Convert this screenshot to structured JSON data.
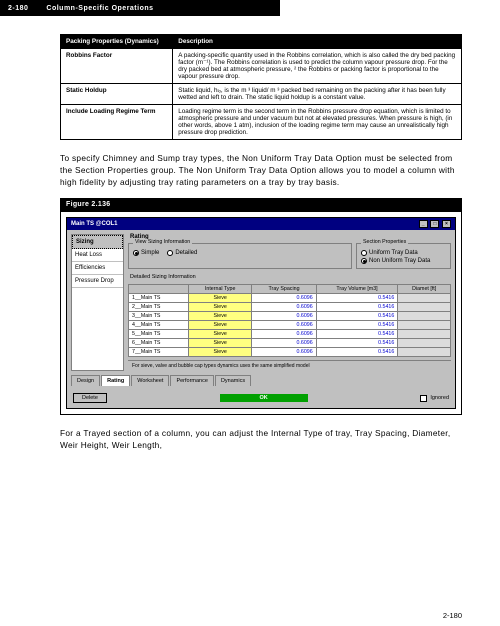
{
  "header": {
    "section_num": "2-180",
    "section_title": "Column-Specific Operations"
  },
  "prop_table": {
    "head": [
      "Packing Properties (Dynamics)",
      "Description"
    ],
    "rows": [
      {
        "name": "Robbins Factor",
        "desc": "A packing-specific quantity used in the Robbins correlation, which is also called the dry bed packing factor (m⁻¹). The Robbins correlation is used to predict the column vapour pressure drop. For the dry packed bed at atmospheric pressure, ² the Robbins or packing factor is proportional to the vapour pressure drop."
      },
      {
        "name": "Static Holdup",
        "desc": "Static liquid, hₗₒ, is the m ³ liquid/ m ³ packed bed remaining on the packing after it has been fully wetted and left to drain. The static liquid holdup is a constant value."
      },
      {
        "name": "Include Loading Regime Term",
        "desc": "Loading regime term is the second term in the Robbins pressure drop equation, which is limited to atmospheric pressure and under vacuum but not at elevated pressures. When pressure is high, (in other words, above 1 atm), inclusion of the loading regime term may cause an unrealistically high pressure drop prediction."
      }
    ]
  },
  "para1": "To specify Chimney and Sump tray types, the Non Uniform Tray Data Option must be selected from the Section Properties group. The Non Uniform Tray Data Option allows you to model a column with high fidelity by adjusting tray rating parameters on a tray by tray basis.",
  "figure_label": "Figure 2.136",
  "win": {
    "title": "Main TS @COL1",
    "nav": [
      "Sizing",
      "Heat Loss",
      "Efficiencies",
      "Pressure Drop"
    ],
    "nav_selected": 0,
    "rating_label": "Rating",
    "view_sizing_label": "View Sizing Information",
    "radios": [
      {
        "label": "Simple",
        "on": true
      },
      {
        "label": "Detailed",
        "on": false
      }
    ],
    "section_props_label": "Section Properties",
    "section_opts": [
      {
        "label": "Uniform Tray Data",
        "on": false
      },
      {
        "label": "Non Uniform Tray Data",
        "on": true
      }
    ],
    "detail_title": "Detailed Sizing Information",
    "grid_head": [
      "",
      "Internal Type",
      "Tray Spacing",
      "Tray Volume [m3]",
      "Diamet [ft]"
    ],
    "grid_rows": [
      {
        "name": "1__Main TS",
        "type": "Sieve",
        "spacing": "0.6096",
        "vol": "0.5416",
        "diam": ""
      },
      {
        "name": "2__Main TS",
        "type": "Sieve",
        "spacing": "0.6096",
        "vol": "0.5416",
        "diam": ""
      },
      {
        "name": "3__Main TS",
        "type": "Sieve",
        "spacing": "0.6096",
        "vol": "0.5416",
        "diam": ""
      },
      {
        "name": "4__Main TS",
        "type": "Sieve",
        "spacing": "0.6096",
        "vol": "0.5416",
        "diam": ""
      },
      {
        "name": "5__Main TS",
        "type": "Sieve",
        "spacing": "0.6096",
        "vol": "0.5416",
        "diam": ""
      },
      {
        "name": "6__Main TS",
        "type": "Sieve",
        "spacing": "0.6096",
        "vol": "0.5416",
        "diam": ""
      },
      {
        "name": "7__Main TS",
        "type": "Sieve",
        "spacing": "0.6096",
        "vol": "0.5416",
        "diam": ""
      }
    ],
    "hint": "For sieve, valve and bubble cap types dynamics uses the same simplified model",
    "tabs": [
      "Design",
      "Rating",
      "Worksheet",
      "Performance",
      "Dynamics"
    ],
    "active_tab": 1,
    "delete_label": "Delete",
    "status_label": "OK",
    "ignored_label": "Ignored"
  },
  "para2": "For a Trayed section of a column, you can adjust the Internal Type of tray, Tray Spacing, Diameter, Weir Height, Weir Length,",
  "page_num": "2-180"
}
